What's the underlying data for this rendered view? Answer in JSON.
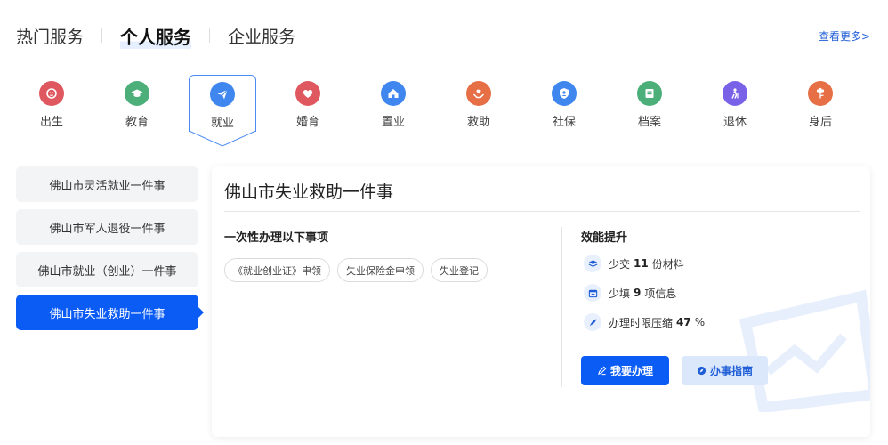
{
  "top_tabs": {
    "items": [
      "热门服务",
      "个人服务",
      "企业服务"
    ],
    "active_index": 1,
    "more_link": "查看更多>"
  },
  "categories": [
    {
      "label": "出生",
      "icon": "baby-icon",
      "color": "#e0585f"
    },
    {
      "label": "教育",
      "icon": "graduation-cap-icon",
      "color": "#4caf7a"
    },
    {
      "label": "就业",
      "icon": "paper-plane-icon",
      "color": "#3f86ee"
    },
    {
      "label": "婚育",
      "icon": "heart-icon",
      "color": "#e0585f"
    },
    {
      "label": "置业",
      "icon": "house-icon",
      "color": "#3f86ee"
    },
    {
      "label": "救助",
      "icon": "hands-heart-icon",
      "color": "#e66f45"
    },
    {
      "label": "社保",
      "icon": "shield-user-icon",
      "color": "#3f86ee"
    },
    {
      "label": "档案",
      "icon": "folder-icon",
      "color": "#4caf7a"
    },
    {
      "label": "退休",
      "icon": "retiree-icon",
      "color": "#7a62e8"
    },
    {
      "label": "身后",
      "icon": "flower-icon",
      "color": "#e66f45"
    }
  ],
  "active_category_index": 2,
  "side_list": {
    "items": [
      "佛山市灵活就业一件事",
      "佛山市军人退役一件事",
      "佛山市就业（创业）一件事",
      "佛山市失业救助一件事"
    ],
    "active_index": 3
  },
  "panel": {
    "title": "佛山市失业救助一件事",
    "items_section_title": "一次性办理以下事项",
    "chips": [
      "《就业创业证》申领",
      "失业保险金申领",
      "失业登记"
    ],
    "efficiency_title": "效能提升",
    "efficiency": [
      {
        "prefix": "少交",
        "value": "11",
        "suffix": "份材料",
        "icon": "layers-icon"
      },
      {
        "prefix": "少填",
        "value": "9",
        "suffix": "项信息",
        "icon": "calendar-icon"
      },
      {
        "prefix": "办理时限压缩",
        "value": "47",
        "suffix": "%",
        "icon": "feather-icon"
      }
    ],
    "primary_button": "我要办理",
    "secondary_button": "办事指南"
  }
}
